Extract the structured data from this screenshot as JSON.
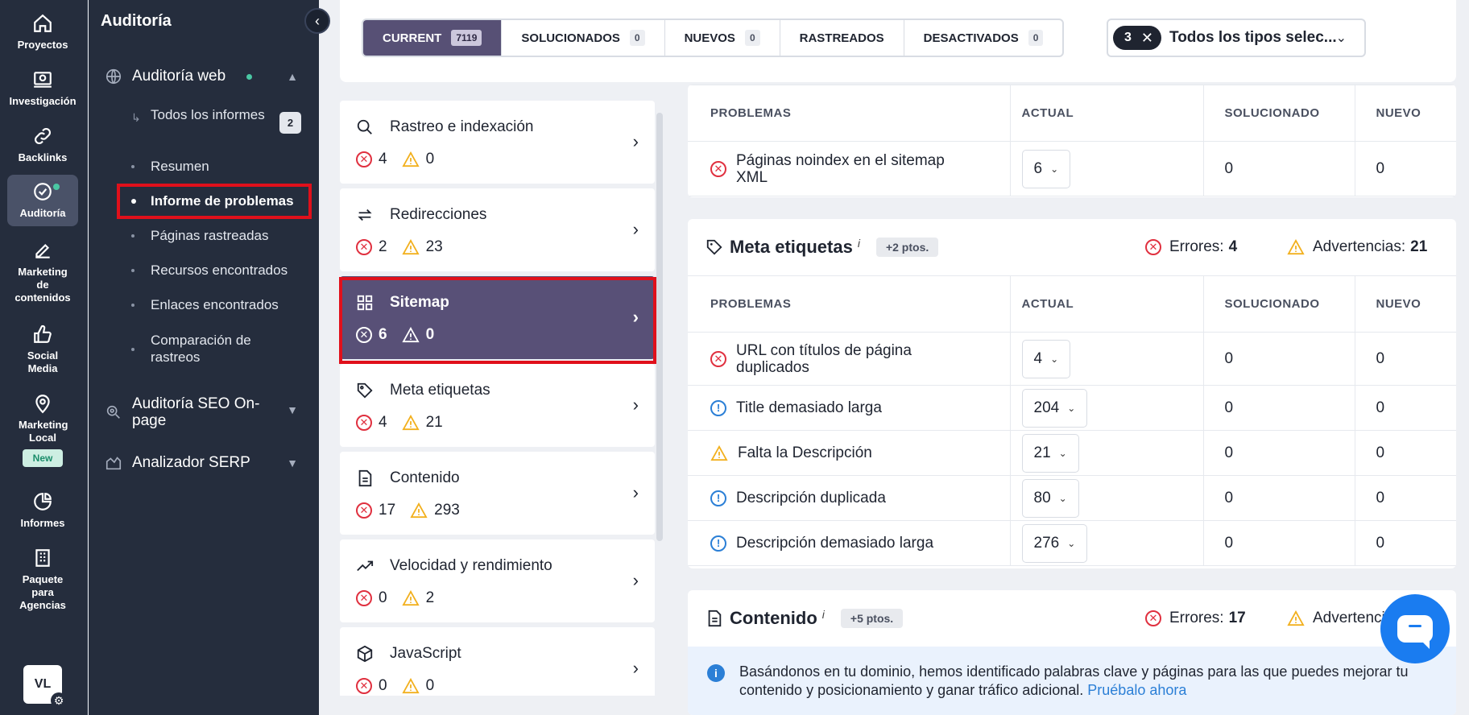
{
  "rail": {
    "items": [
      {
        "label": "Proyectos",
        "icon": "home-icon"
      },
      {
        "label": "Investigación",
        "icon": "research-icon"
      },
      {
        "label": "Backlinks",
        "icon": "link-icon"
      },
      {
        "label": "Auditoría",
        "icon": "audit-icon"
      },
      {
        "label": "Marketing de contenidos",
        "icon": "edit-icon"
      },
      {
        "label": "Social Media",
        "icon": "thumbs-up-icon"
      },
      {
        "label": "Marketing Local",
        "icon": "location-pin-icon"
      },
      {
        "label": "Informes",
        "icon": "pie-chart-icon"
      },
      {
        "label": "Paquete para Agencias",
        "icon": "building-icon"
      }
    ],
    "new_badge": "New",
    "avatar": "VL"
  },
  "sidebar": {
    "title": "Auditoría",
    "group1": "Auditoría web",
    "links": {
      "todos": "Todos los informes",
      "todos_count": "2",
      "resumen": "Resumen",
      "informe": "Informe de problemas",
      "paginas": "Páginas rastreadas",
      "recursos": "Recursos encontrados",
      "enlaces": "Enlaces encontrados",
      "comparacion": "Comparación de rastreos"
    },
    "group2": "Auditoría SEO On-page",
    "group3": "Analizador SERP"
  },
  "tabs": [
    {
      "label": "CURRENT",
      "count": "7119"
    },
    {
      "label": "SOLUCIONADOS",
      "count": "0"
    },
    {
      "label": "NUEVOS",
      "count": "0"
    },
    {
      "label": "RASTREADOS",
      "count": ""
    },
    {
      "label": "DESACTIVADOS",
      "count": "0"
    }
  ],
  "type_filter": {
    "chip": "3",
    "text": "Todos los tipos selec..."
  },
  "categories": [
    {
      "name": "Rastreo e indexación",
      "errors": "4",
      "warnings": "0"
    },
    {
      "name": "Redirecciones",
      "errors": "2",
      "warnings": "23"
    },
    {
      "name": "Sitemap",
      "errors": "6",
      "warnings": "0"
    },
    {
      "name": "Meta etiquetas",
      "errors": "4",
      "warnings": "21"
    },
    {
      "name": "Contenido",
      "errors": "17",
      "warnings": "293"
    },
    {
      "name": "Velocidad y rendimiento",
      "errors": "0",
      "warnings": "2"
    },
    {
      "name": "JavaScript",
      "errors": "0",
      "warnings": "0"
    }
  ],
  "columns": {
    "problems": "PROBLEMAS",
    "current": "ACTUAL",
    "solved": "SOLUCIONADO",
    "new": "NUEVO"
  },
  "sitemap_rows": [
    {
      "label": "Páginas noindex en el sitemap XML",
      "current": "6",
      "solved": "0",
      "new": "0"
    }
  ],
  "meta": {
    "title": "Meta etiquetas",
    "info": "i",
    "points": "+2 ptos.",
    "errors_label": "Errores:",
    "errors": "4",
    "warnings_label": "Advertencias:",
    "warnings": "21",
    "rows": [
      {
        "label": "URL con títulos de página duplicados",
        "current": "4",
        "solved": "0",
        "new": "0"
      },
      {
        "label": "Title demasiado larga",
        "current": "204",
        "solved": "0",
        "new": "0"
      },
      {
        "label": "Falta la Descripción",
        "current": "21",
        "solved": "0",
        "new": "0"
      },
      {
        "label": "Descripción duplicada",
        "current": "80",
        "solved": "0",
        "new": "0"
      },
      {
        "label": "Descripción demasiado larga",
        "current": "276",
        "solved": "0",
        "new": "0"
      }
    ]
  },
  "content": {
    "title": "Contenido",
    "info": "i",
    "points": "+5 ptos.",
    "errors_label": "Errores:",
    "errors": "17",
    "warnings_label": "Advertencia",
    "banner_text": "Basándonos en tu dominio, hemos identificado palabras clave y páginas para las que puedes mejorar tu contenido y posicionamiento y ganar tráfico adicional.",
    "banner_link": "Pruébalo ahora"
  },
  "colors": {
    "accent": "#585077",
    "error": "#e0303f",
    "warning": "#f2b01e",
    "notice": "#2b7fd6",
    "highlight": "#e0101b",
    "chat": "#1a7cf0"
  }
}
